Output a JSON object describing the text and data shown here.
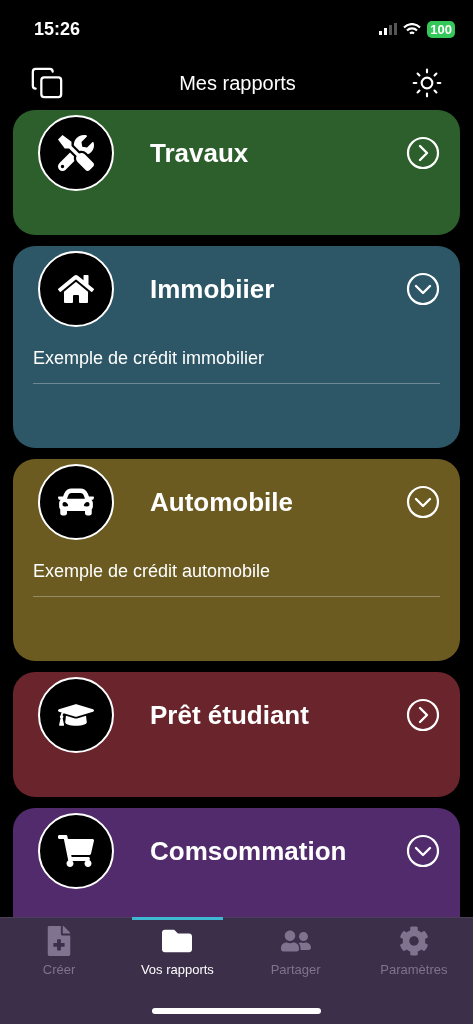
{
  "status_bar": {
    "time": "15:26",
    "battery": "100"
  },
  "nav": {
    "title": "Mes rapports"
  },
  "categories": [
    {
      "kind": "tools",
      "title": "Travaux",
      "color": "#2d5f2c",
      "expanded": false
    },
    {
      "kind": "house",
      "title": "Immobiier",
      "color": "#2d5766",
      "expanded": true,
      "items": [
        "Exemple de crédit immobilier"
      ]
    },
    {
      "kind": "car",
      "title": "Automobile",
      "color": "#6b5b20",
      "expanded": true,
      "items": [
        "Exemple de crédit automobile"
      ]
    },
    {
      "kind": "graduation",
      "title": "Prêt étudiant",
      "color": "#6a242b",
      "expanded": false
    },
    {
      "kind": "cart",
      "title": "Comsommation",
      "color": "#512b6c",
      "expanded": true
    }
  ],
  "tabs": [
    {
      "kind": "create",
      "label": "Créer",
      "selected": false
    },
    {
      "kind": "folder",
      "label": "Vos rapports",
      "selected": true
    },
    {
      "kind": "share",
      "label": "Partager",
      "selected": false
    },
    {
      "kind": "settings",
      "label": "Paramètres",
      "selected": false
    }
  ]
}
